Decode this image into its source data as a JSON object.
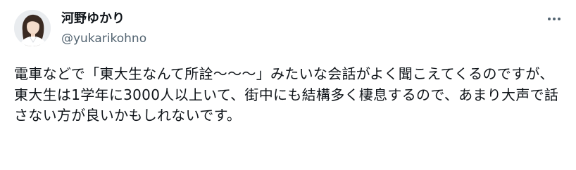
{
  "author": {
    "display_name": "河野ゆかり",
    "handle": "@yukarikohno",
    "avatar_icon": "profile-photo-icon"
  },
  "menu": {
    "more_icon": "more-horizontal-icon"
  },
  "tweet": {
    "text": "電車などで「東大生なんて所詮〜〜〜」みたいな会話がよく聞こえてくるのですが、\n東大生は1学年に3000人以上いて、街中にも結構多く棲息するので、あまり大声で話さない方が良いかもしれないです。"
  },
  "colors": {
    "text_primary": "#0f1419",
    "text_secondary": "#536471",
    "background": "#ffffff"
  }
}
